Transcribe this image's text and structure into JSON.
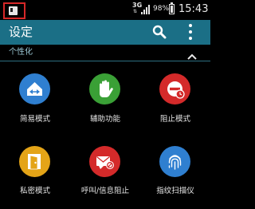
{
  "status_bar": {
    "network": "3G",
    "battery_percent": "98%",
    "time": "15:43"
  },
  "app_bar": {
    "title": "设定",
    "search_icon": "search-icon",
    "more_icon": "more-vert-icon"
  },
  "section": {
    "label": "个性化",
    "toggle_icon": "chevron-up-icon"
  },
  "items": [
    {
      "label": "简易模式",
      "icon": "easy-mode-icon",
      "color": "#2f7fd0"
    },
    {
      "label": "辅助功能",
      "icon": "hand-icon",
      "color": "#3aa036"
    },
    {
      "label": "阻止模式",
      "icon": "blocking-mode-icon",
      "color": "#d42a2a"
    },
    {
      "label": "私密模式",
      "icon": "private-door-icon",
      "color": "#e4a417"
    },
    {
      "label": "呼叫/信息阻止",
      "icon": "call-block-icon",
      "color": "#d42a2a"
    },
    {
      "label": "指纹扫描仪",
      "icon": "fingerprint-icon",
      "color": "#2f7fd0"
    }
  ]
}
